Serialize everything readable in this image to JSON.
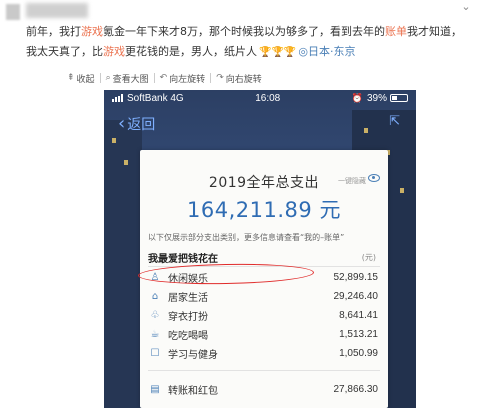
{
  "post": {
    "text_1": "前年，我打",
    "kw_game": "游戏",
    "text_2": "氪金一年下来才8万，那个时候我以为够多了，看到去年的",
    "kw_bill": "账单",
    "text_3": "我才知道，我太天真了，比",
    "kw_game2": "游戏",
    "text_4": "更花钱的是，男人，纸片人",
    "trophies": "🏆🏆🏆",
    "location": "◎日本·东京"
  },
  "toolbar": {
    "collapse": "收起",
    "view_large": "查看大图",
    "rotate_left": "向左旋转",
    "rotate_right": "向右旋转"
  },
  "phone": {
    "carrier": "SoftBank",
    "network": "4G",
    "time": "16:08",
    "battery": "39%",
    "back_label": "返回"
  },
  "card": {
    "title": "2019全年总支出",
    "generate_label": "一键隐藏",
    "total": "164,211.89 元",
    "note": "以下仅展示部分支出类别，更多信息请查看“我的–账单”",
    "heading": "我最爱把钱花在",
    "unit": "(元)",
    "rows": [
      {
        "icon": "♙",
        "label": "休闲娱乐",
        "value": "52,899.15"
      },
      {
        "icon": "⌂",
        "label": "居家生活",
        "value": "29,246.40"
      },
      {
        "icon": "♧",
        "label": "穿衣打扮",
        "value": "8,641.41"
      },
      {
        "icon": "☕",
        "label": "吃吃喝喝",
        "value": "1,513.21"
      },
      {
        "icon": "☐",
        "label": "学习与健身",
        "value": "1,050.99"
      },
      {
        "icon": "▤",
        "label": "转账和红包",
        "value": "27,866.30"
      }
    ]
  },
  "colors": {
    "keyword": "#eb7350",
    "link": "#4a7fb6",
    "total": "#2f6cb3",
    "highlight": "#e02b2b"
  }
}
